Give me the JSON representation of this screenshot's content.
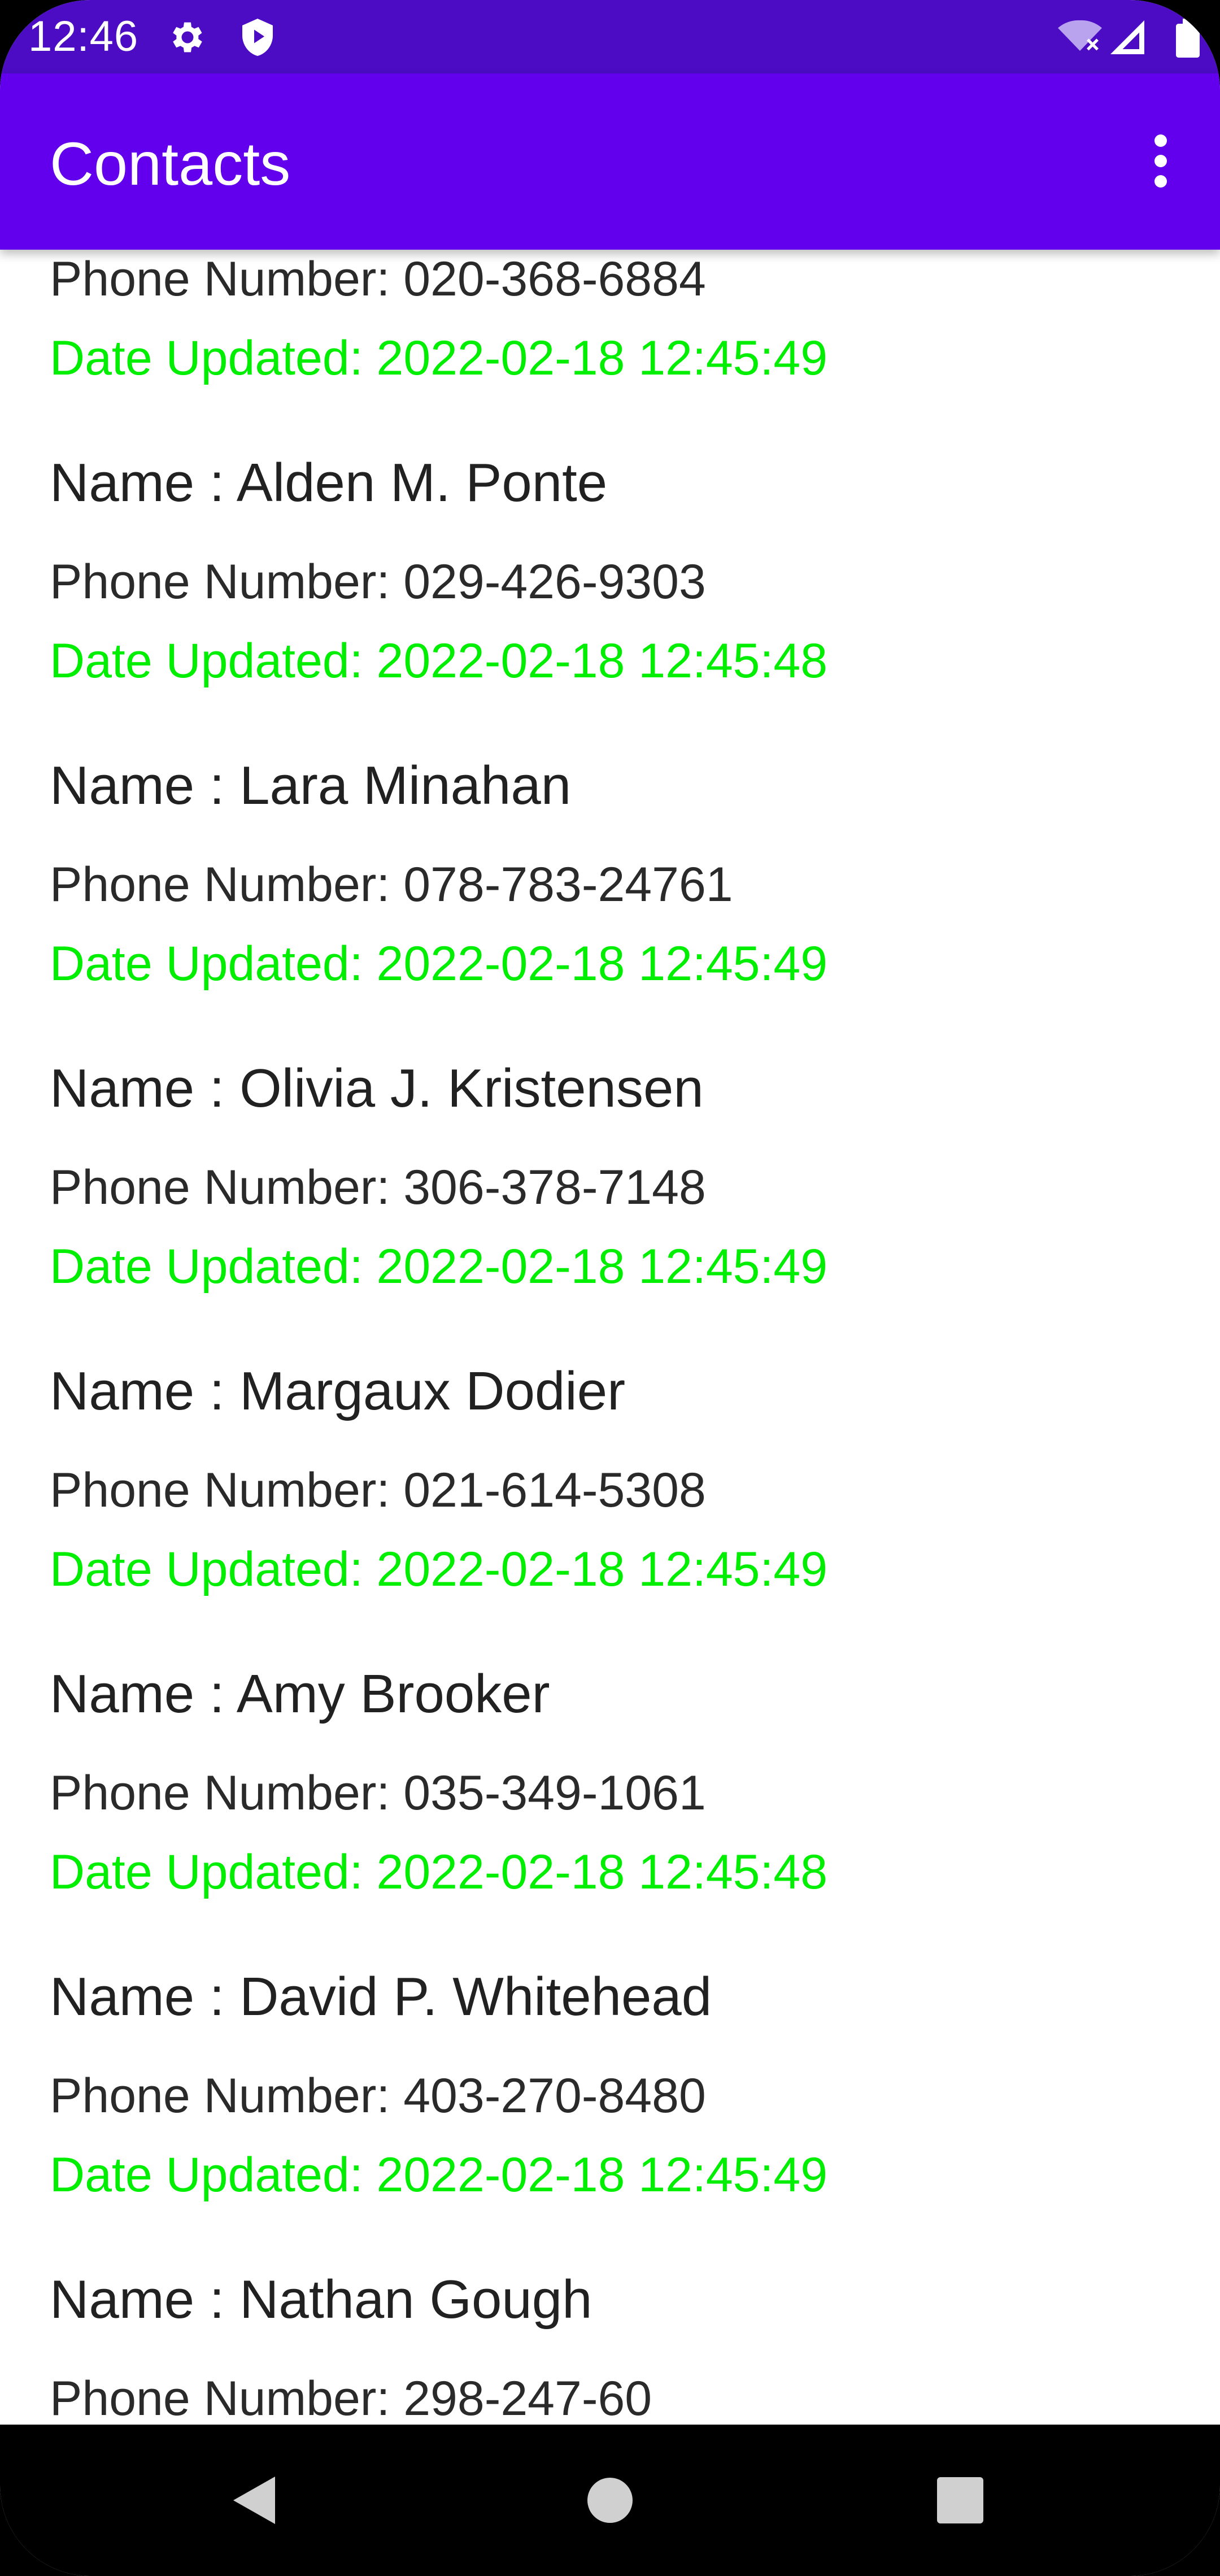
{
  "status_bar": {
    "time": "12:46",
    "icons": [
      "gear-icon",
      "shield-play-icon",
      "wifi-off-icon",
      "cellular-signal-icon",
      "battery-icon"
    ]
  },
  "app_bar": {
    "title": "Contacts",
    "menu_icon": "more-vert-icon"
  },
  "colors": {
    "status_bar": "#4b0cc4",
    "app_bar": "#6200ee",
    "date_text": "#00ee00",
    "nav_bar": "#000000"
  },
  "contacts": [
    {
      "name": "",
      "phone": "Phone Number: 020-368-6884",
      "date": "Date Updated: 2022-02-18 12:45:49"
    },
    {
      "name": "Name : Alden M. Ponte",
      "phone": "Phone Number: 029-426-9303",
      "date": "Date Updated: 2022-02-18 12:45:48"
    },
    {
      "name": "Name : Lara Minahan",
      "phone": "Phone Number: 078-783-24761",
      "date": "Date Updated: 2022-02-18 12:45:49"
    },
    {
      "name": "Name : Olivia J. Kristensen",
      "phone": "Phone Number: 306-378-7148",
      "date": "Date Updated: 2022-02-18 12:45:49"
    },
    {
      "name": "Name : Margaux Dodier",
      "phone": "Phone Number: 021-614-5308",
      "date": "Date Updated: 2022-02-18 12:45:49"
    },
    {
      "name": "Name : Amy Brooker",
      "phone": "Phone Number: 035-349-1061",
      "date": "Date Updated: 2022-02-18 12:45:48"
    },
    {
      "name": "Name : David P. Whitehead",
      "phone": "Phone Number: 403-270-8480",
      "date": "Date Updated: 2022-02-18 12:45:49"
    },
    {
      "name": "Name : Nathan Gough",
      "phone": "Phone Number: 298-247-60",
      "date": ""
    }
  ],
  "nav_bar": {
    "buttons": [
      "back-icon",
      "home-icon",
      "recents-icon"
    ]
  }
}
